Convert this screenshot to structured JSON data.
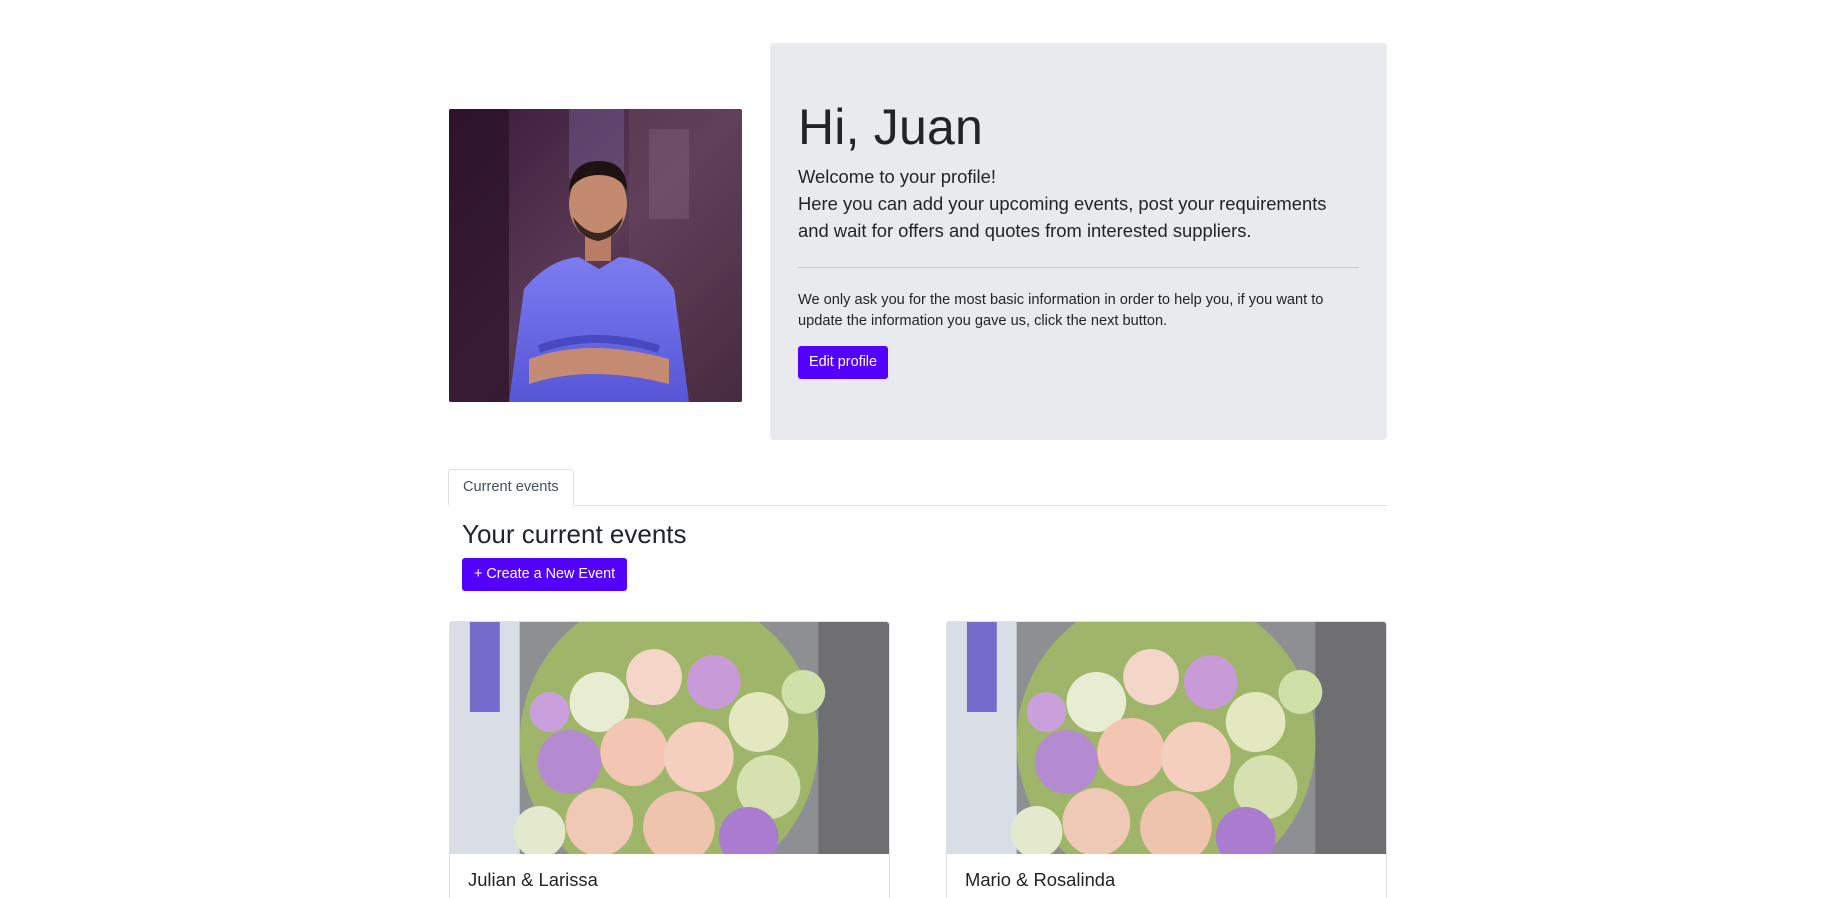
{
  "profile": {
    "greeting": "Hi, Juan",
    "welcome": "Welcome to your profile!",
    "description": "Here you can add your upcoming events, post your requirements and wait for offers and quotes from interested suppliers.",
    "info": "We only ask you for the most basic information in order to help you, if you want to update the information you gave us, click the next button.",
    "edit_button": "Edit profile"
  },
  "tabs": [
    {
      "label": "Current events",
      "active": true
    }
  ],
  "events_section": {
    "title": "Your current events",
    "create_button": "+ Create a New Event",
    "events": [
      {
        "name": "Julian & Larissa"
      },
      {
        "name": "Mario & Rosalinda"
      }
    ]
  },
  "colors": {
    "primary": "#5300ff",
    "jumbotron_bg": "#e9eaed",
    "text": "#212529"
  }
}
